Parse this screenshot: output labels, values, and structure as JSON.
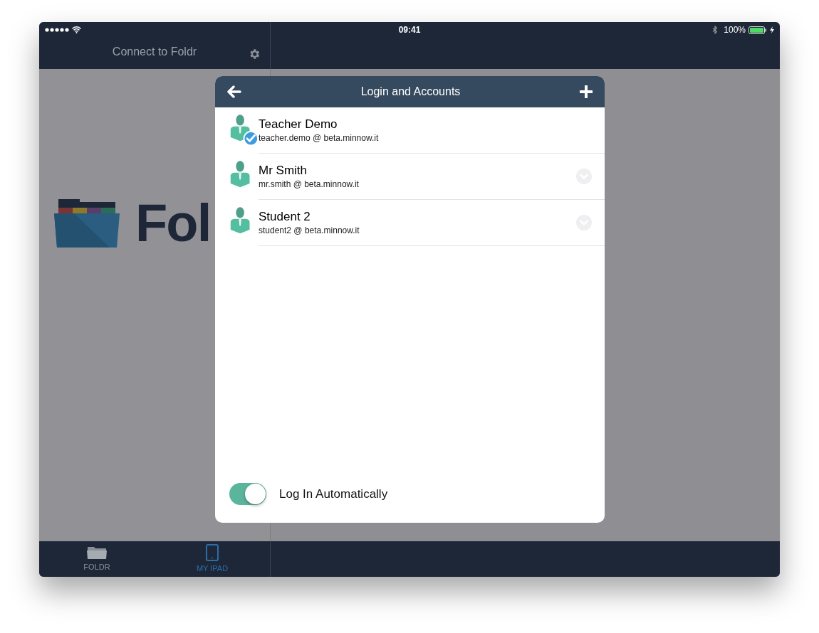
{
  "status_bar": {
    "time": "09:41",
    "battery": "100%"
  },
  "sidebar": {
    "title": "Connect to Foldr",
    "logo_text": "Fol"
  },
  "tab_bar": [
    {
      "label": "FOLDR",
      "selected": false
    },
    {
      "label": "MY IPAD",
      "selected": true
    }
  ],
  "dialog": {
    "title": "Login and Accounts",
    "accounts": [
      {
        "name": "Teacher Demo",
        "address": "teacher.demo @ beta.minnow.it",
        "selected": true
      },
      {
        "name": "Mr Smith",
        "address": "mr.smith @ beta.minnow.it",
        "selected": false
      },
      {
        "name": "Student 2",
        "address": "student2 @ beta.minnow.it",
        "selected": false
      }
    ],
    "auto_login": {
      "label": "Log In Automatically",
      "on": true
    }
  }
}
